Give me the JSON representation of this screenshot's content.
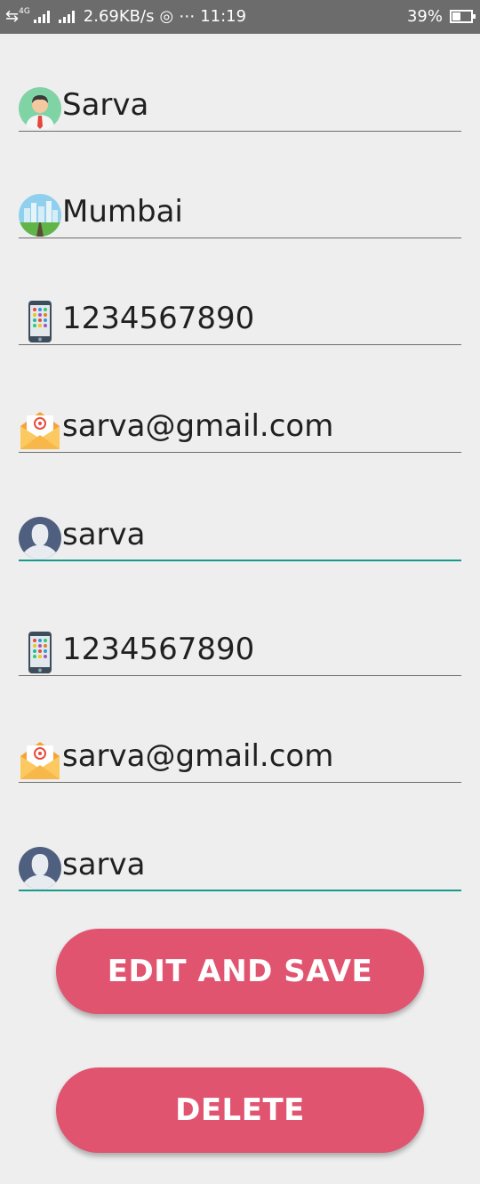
{
  "status_bar": {
    "network": "4G",
    "speed": "2.69KB/s",
    "dots": "⋯",
    "time": "11:19",
    "battery": "39%",
    "battery_level": 0.39
  },
  "form": {
    "fields": [
      {
        "icon": "businessman-avatar-icon",
        "value": "Sarva"
      },
      {
        "icon": "city-landscape-icon",
        "value": "Mumbai"
      },
      {
        "icon": "smartphone-icon",
        "value": "1234567890"
      },
      {
        "icon": "email-envelope-icon",
        "value": "sarva@gmail.com"
      },
      {
        "icon": "user-silhouette-icon",
        "value": "sarva"
      },
      {
        "icon": "smartphone-icon",
        "value": "1234567890"
      },
      {
        "icon": "email-envelope-icon",
        "value": "sarva@gmail.com"
      },
      {
        "icon": "user-silhouette-icon",
        "value": "sarva"
      }
    ]
  },
  "buttons": {
    "edit_save": "EDIT AND SAVE",
    "delete": "DELETE"
  },
  "colors": {
    "button": "#e0546f",
    "focused_underline": "#159a8d",
    "background": "#eeeeee",
    "status_bar": "#6c6c6c"
  }
}
